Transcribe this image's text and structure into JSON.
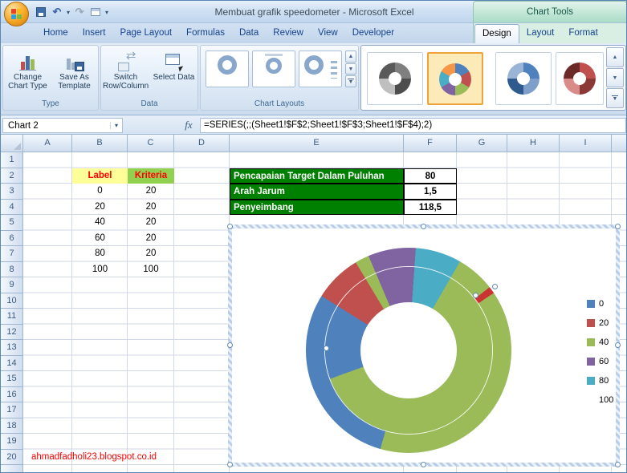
{
  "window": {
    "title": "Membuat grafik speedometer - Microsoft Excel",
    "context_header": "Chart Tools"
  },
  "icons": {
    "dropdown": "▾",
    "undo": "↶",
    "redo": "↷",
    "up": "▲",
    "down": "▼"
  },
  "tabs": {
    "standard": [
      "Home",
      "Insert",
      "Page Layout",
      "Formulas",
      "Data",
      "Review",
      "View",
      "Developer"
    ],
    "contextual": [
      "Design",
      "Layout",
      "Format"
    ],
    "active": "Design"
  },
  "ribbon": {
    "type_group": {
      "label": "Type",
      "change_chart_type": "Change Chart Type",
      "save_as_template": "Save As Template"
    },
    "data_group": {
      "label": "Data",
      "switch_row_column": "Switch Row/Column",
      "select_data": "Select Data"
    },
    "layouts_group": {
      "label": "Chart Layouts"
    }
  },
  "formula_bar": {
    "name_box": "Chart 2",
    "fx_label": "fx",
    "formula": "=SERIES(;;(Sheet1!$F$2;Sheet1!$F$3;Sheet1!$F$4);2)"
  },
  "sheet": {
    "column_headers": [
      "A",
      "B",
      "C",
      "D",
      "E",
      "F",
      "G",
      "H",
      "I"
    ],
    "row_count": 20,
    "cells": {
      "b2": "Label",
      "c2": "Kriteria",
      "label_values": [
        "0",
        "20",
        "40",
        "60",
        "80",
        "100"
      ],
      "kriteria_values": [
        "20",
        "20",
        "20",
        "20",
        "20",
        "100"
      ],
      "e2": "Pencapaian Target Dalam Puluhan",
      "f2": "80",
      "e3": "Arah Jarum",
      "f3": "1,5",
      "e4": "Penyeimbang",
      "f4": "118,5",
      "watermark": "ahmadfadholi23.blogspot.co.id"
    },
    "colors": {
      "label_header_fill": "#ffff99",
      "kriteria_header_fill": "#92d050",
      "header_text": "#ff0000",
      "target_fill": "#008000",
      "target_text": "#ffffff"
    }
  },
  "chart_data": {
    "type": "doughnut",
    "legend_position": "right",
    "categories": [
      "0",
      "20",
      "40",
      "60",
      "80",
      "100"
    ],
    "series": [
      {
        "name": "Kriteria",
        "ring": "inner",
        "values": [
          20,
          20,
          20,
          20,
          20,
          100
        ]
      },
      {
        "name": "Arah Jarum",
        "ring": "outer",
        "values": [
          80,
          1.5,
          118.5
        ]
      }
    ],
    "legend": [
      {
        "label": "0",
        "color": "#4f81bd"
      },
      {
        "label": "20",
        "color": "#c0504d"
      },
      {
        "label": "40",
        "color": "#9bbb59"
      },
      {
        "label": "60",
        "color": "#8064a2"
      },
      {
        "label": "80",
        "color": "#4bacc6"
      },
      {
        "label": "100",
        "color": "none"
      }
    ]
  }
}
